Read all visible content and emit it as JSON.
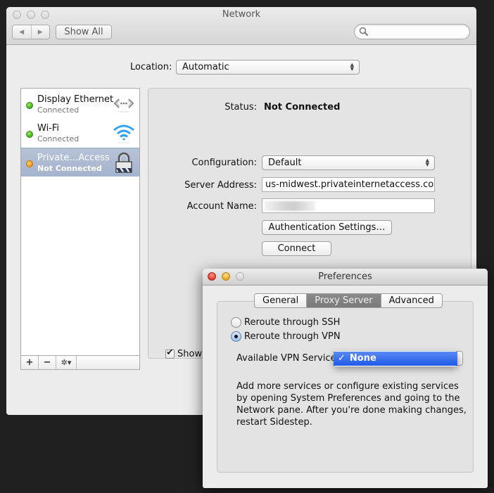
{
  "network_window": {
    "title": "Network",
    "nav_back_icon": "◀",
    "nav_forward_icon": "▶",
    "show_all_label": "Show All",
    "search_placeholder": "",
    "location_label": "Location:",
    "location_value": "Automatic",
    "services": [
      {
        "name": "Display Ethernet",
        "status": "Connected",
        "dot": "green",
        "icon": "ethernet-icon"
      },
      {
        "name": "Wi-Fi",
        "status": "Connected",
        "dot": "green",
        "icon": "wifi-icon"
      },
      {
        "name": "Private…Access",
        "status": "Not Connected",
        "dot": "orange",
        "icon": "vpn-lock-icon",
        "selected": true
      }
    ],
    "toolbar": {
      "add": "+",
      "remove": "−",
      "gear": "✲▾"
    },
    "detail": {
      "status_label": "Status:",
      "status_value": "Not Connected",
      "configuration_label": "Configuration:",
      "configuration_value": "Default",
      "server_address_label": "Server Address:",
      "server_address_value": "us-midwest.privateinternetaccess.com",
      "account_name_label": "Account Name:",
      "account_name_value": "",
      "auth_settings_button": "Authentication Settings…",
      "connect_button": "Connect",
      "show_checkbox_label": "Show",
      "show_checkbox_checked": true
    }
  },
  "preferences_window": {
    "title": "Preferences",
    "tabs": [
      {
        "label": "General",
        "active": false
      },
      {
        "label": "Proxy Server",
        "active": true
      },
      {
        "label": "Advanced",
        "active": false
      }
    ],
    "radio_options": [
      {
        "label": "Reroute through SSH",
        "selected": false
      },
      {
        "label": "Reroute through VPN",
        "selected": true
      }
    ],
    "vpn_services_label": "Available VPN Services",
    "vpn_services_menu": [
      {
        "label": "None",
        "checked": true,
        "highlighted": true
      }
    ],
    "check_mark": "✓",
    "help_text": "Add more services or configure existing services by opening System Preferences and going to the Network pane. After you're done making changes, restart Sidestep."
  }
}
